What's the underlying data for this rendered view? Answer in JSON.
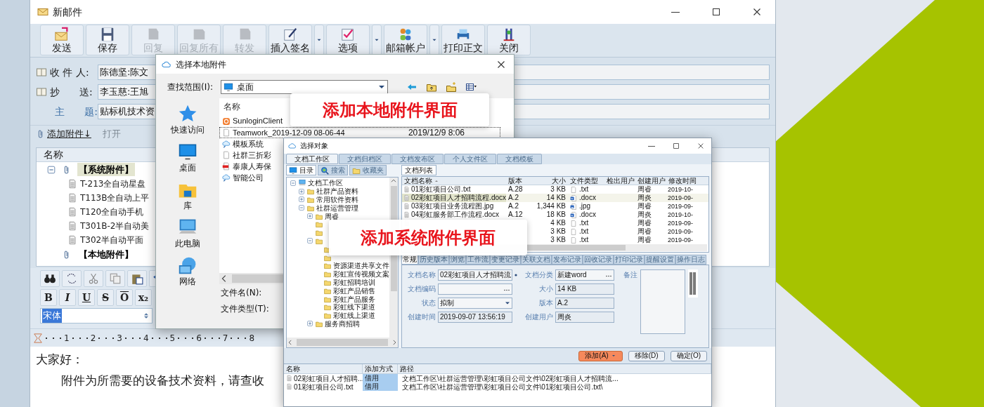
{
  "mail_window": {
    "title": "新邮件",
    "toolbar": [
      {
        "label": "发送",
        "disabled": false,
        "dropdown": false
      },
      {
        "label": "保存",
        "disabled": false,
        "dropdown": false
      },
      {
        "label": "回复",
        "disabled": true,
        "dropdown": false
      },
      {
        "label": "回复所有",
        "disabled": true,
        "dropdown": false
      },
      {
        "label": "转发",
        "disabled": true,
        "dropdown": false
      },
      {
        "label": "插入签名",
        "disabled": false,
        "dropdown": true
      },
      {
        "label": "选项",
        "disabled": false,
        "dropdown": true
      },
      {
        "label": "邮箱帐户",
        "disabled": false,
        "dropdown": true
      },
      {
        "label": "打印正文",
        "disabled": false,
        "dropdown": false
      },
      {
        "label": "关闭",
        "disabled": false,
        "dropdown": false
      }
    ],
    "fields": [
      {
        "label": "收 件 人:",
        "value": "陈德坚:陈文",
        "kind": "address"
      },
      {
        "label": "抄　　送:",
        "value": "李玉慈:王旭",
        "kind": "address"
      },
      {
        "label": "主　　题:",
        "value": "贴标机技术资",
        "kind": "subject"
      }
    ],
    "attachment_actions": [
      {
        "label": "添加附件↓",
        "disabled": false
      },
      {
        "label": "打开",
        "disabled": true
      }
    ],
    "attachment_tree": {
      "column": "名称",
      "groups": [
        {
          "label": "【系统附件】",
          "selected": true,
          "children": [
            {
              "label": "T-213全自动星盘"
            },
            {
              "label": "T113B全自动上平"
            },
            {
              "label": "T120全自动手机"
            },
            {
              "label": "T301B-2半自动美"
            },
            {
              "label": "T302半自动平面"
            }
          ]
        },
        {
          "label": "【本地附件】",
          "selected": false
        }
      ]
    },
    "format_buttons": [
      "B",
      "I",
      "U",
      "S",
      "Ō",
      "x₂"
    ],
    "font": "宋体",
    "ruler": [
      "1",
      "2",
      "3",
      "4",
      "5",
      "6",
      "7",
      "8"
    ],
    "body": [
      "大家好：",
      "附件为所需要的设备技术资料，请查收"
    ]
  },
  "local_dialog": {
    "title": "选择本地附件",
    "look_in_label": "查找范围(I):",
    "look_in": "桌面",
    "places": [
      "快速访问",
      "桌面",
      "库",
      "此电脑",
      "网络"
    ],
    "column": "名称",
    "files": [
      {
        "name": "SunloginClient",
        "kind": "app",
        "selected": false
      },
      {
        "name": "Teamwork_2019-12-09 08-06-44",
        "date": "2019/12/9 8:06",
        "kind": "file",
        "selected": true
      },
      {
        "name": "模板系统",
        "kind": "link",
        "selected": false
      },
      {
        "name": "社群三折彩",
        "kind": "file",
        "selected": false
      },
      {
        "name": "泰康人寿保",
        "kind": "pdf",
        "selected": false
      },
      {
        "name": "智能公司",
        "kind": "link",
        "selected": false
      }
    ],
    "file_name_label": "文件名(N):",
    "file_type_label": "文件类型(T):"
  },
  "select_dialog": {
    "title": "选择对象",
    "tabs": [
      {
        "label": "文档工作区",
        "selected": true
      },
      {
        "label": "文档归档区",
        "selected": false
      },
      {
        "label": "文档发布区",
        "selected": false
      },
      {
        "label": "个人文件区",
        "selected": false
      },
      {
        "label": "文档模板",
        "selected": false
      }
    ],
    "subtabs": [
      {
        "label": "目录",
        "selected": true
      },
      {
        "label": "搜索",
        "selected": false
      },
      {
        "label": "收藏夹",
        "selected": false
      }
    ],
    "tree": [
      {
        "label": "文档工作区",
        "kind": "computer",
        "expanded": true,
        "children": [
          {
            "label": "社群产品资料",
            "kind": "folder",
            "expanded": false
          },
          {
            "label": "常用软件资料",
            "kind": "folder",
            "expanded": false
          },
          {
            "label": "社群运营管理",
            "kind": "folder",
            "expanded": true,
            "children": [
              {
                "label": "周睿",
                "kind": "folder",
                "expanded": false
              },
              {
                "kind": "folder"
              },
              {
                "kind": "folder"
              },
              {
                "kind": "folder",
                "expanded": true,
                "children": [
                  {
                    "kind": "folder"
                  },
                  {
                    "kind": "folder"
                  },
                  {
                    "label": "资源渠道共享文件",
                    "kind": "folder"
                  },
                  {
                    "label": "彩虹宣传视频文案",
                    "kind": "folder"
                  },
                  {
                    "label": "彩虹招聘培训",
                    "kind": "folder"
                  },
                  {
                    "label": "彩虹产品销售",
                    "kind": "folder"
                  },
                  {
                    "label": "彩虹产品服务",
                    "kind": "folder"
                  },
                  {
                    "label": "彩虹线下渠道",
                    "kind": "folder"
                  },
                  {
                    "label": "彩虹线上渠道",
                    "kind": "folder"
                  }
                ]
              },
              {
                "label": "服务商招聘",
                "kind": "folder",
                "expanded": false
              }
            ]
          }
        ]
      }
    ],
    "list_tab": "文档列表",
    "columns": [
      "文档名称",
      "版本",
      "大小",
      "文件类型",
      "检出用户",
      "创建用户",
      "修改时间"
    ],
    "rows": [
      {
        "name": "01彩虹项目公司.txt",
        "version": "A.28",
        "size": "3 KB",
        "type": ".txt",
        "kind": "text",
        "creator": "周睿",
        "modified": "2019-10-",
        "selected": false
      },
      {
        "name": "02彩虹项目人才招聘流程.docx",
        "version": "A.2",
        "size": "14 KB",
        "type": ".docx",
        "kind": "word",
        "creator": "周炎",
        "modified": "2019-09-",
        "selected": true
      },
      {
        "name": "03彩虹项目业务流程图.jpg",
        "version": "A.2",
        "size": "1,344 KB",
        "type": ".jpg",
        "kind": "image",
        "creator": "周睿",
        "modified": "2019-09-",
        "selected": false
      },
      {
        "name": "04彩虹服务部工作流程.docx",
        "version": "A.12",
        "size": "18 KB",
        "type": ".docx",
        "kind": "word",
        "creator": "周炎",
        "modified": "2019-10-",
        "selected": false
      },
      {
        "size": "4 KB",
        "type": ".txt",
        "kind": "text",
        "creator": "周睿",
        "modified": "2019-09-",
        "selected": false
      },
      {
        "size": "3 KB",
        "type": ".txt",
        "kind": "text",
        "creator": "周睿",
        "modified": "2019-09-",
        "selected": false
      },
      {
        "size": "3 KB",
        "type": ".txt",
        "kind": "text",
        "creator": "周睿",
        "modified": "2019-09-",
        "selected": false
      }
    ],
    "detail_tabs": [
      {
        "label": "常规",
        "selected": true
      },
      {
        "label": "历史版本",
        "selected": false
      },
      {
        "label": "浏览",
        "selected": false
      },
      {
        "label": "工作流",
        "selected": false
      },
      {
        "label": "变更记录",
        "selected": false
      },
      {
        "label": "关联文档",
        "selected": false
      },
      {
        "label": "发布记录",
        "selected": false
      },
      {
        "label": "回收记录",
        "selected": false
      },
      {
        "label": "打印记录",
        "selected": false
      },
      {
        "label": "提醒设置",
        "selected": false
      },
      {
        "label": "操作日志",
        "selected": false
      }
    ],
    "form": [
      {
        "label": "文档名称",
        "value": "02彩虹项目人才招聘流",
        "kind": "text",
        "required": true
      },
      {
        "label": "文档分类",
        "value": "新建word",
        "kind": "picker",
        "required": false
      },
      {
        "label": "文档编码",
        "kind": "picker",
        "required": false
      },
      {
        "label": "大小",
        "value": "14 KB",
        "kind": "readonly",
        "required": false
      },
      {
        "label": "状态",
        "value": "拟制",
        "kind": "select",
        "required": false
      },
      {
        "label": "版本",
        "value": "A.2",
        "kind": "readonly",
        "required": false
      },
      {
        "label": "创建时间",
        "value": "2019-09-07 13:56:19",
        "kind": "readonly",
        "required": false
      },
      {
        "label": "创建用户",
        "value": "周炎",
        "kind": "readonly",
        "required": false
      }
    ],
    "note_label": "备注",
    "buttons": [
      {
        "label": "添加(A)",
        "kind": "primary"
      },
      {
        "label": "移除(D)",
        "kind": "normal"
      },
      {
        "label": "确定(O)",
        "kind": "normal"
      }
    ],
    "picked_columns": [
      "名称",
      "添加方式",
      "路径"
    ],
    "picked": [
      {
        "name": "02彩虹项目人才招聘...",
        "mode": "借用",
        "path": "文档工作区\\社群运营管理\\彩虹项目公司文件\\02彩虹项目人才招聘流..."
      },
      {
        "name": "01彩虹项目公司.txt",
        "mode": "借用",
        "path": "文档工作区\\社群运营管理\\彩虹项目公司文件\\01彩虹项目公司.txt\\"
      }
    ]
  },
  "callouts": [
    "添加本地附件界面",
    "添加系统附件界面"
  ]
}
